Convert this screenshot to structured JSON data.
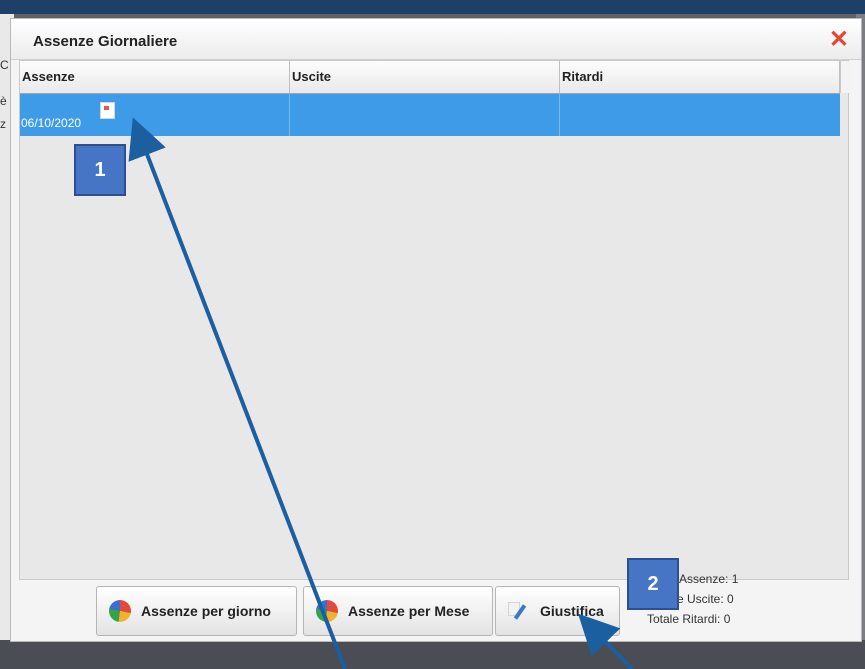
{
  "background": {
    "left_text_lines": [
      "C",
      "è",
      "z"
    ]
  },
  "dialog": {
    "title": "Assenze Giornaliere",
    "close_label": "✕",
    "grid": {
      "columns": [
        "Assenze",
        "Uscite",
        "Ritardi"
      ],
      "rows": [
        {
          "assenze": "06/10/2020",
          "uscite": "",
          "ritardi": ""
        }
      ]
    },
    "buttons": {
      "assenze_per_giorno": "Assenze per giorno",
      "assenze_per_mese": "Assenze per Mese",
      "giustifica": "Giustifica"
    },
    "totals": {
      "assenze": "Assenze: 1",
      "uscite": "e Uscite: 0",
      "ritardi": "Totale Ritardi: 0"
    }
  },
  "annotations": {
    "marker_1": "1",
    "marker_2": "2",
    "arrow_color": "#1b5fa0"
  },
  "colors": {
    "selected_row": "#3d9be8",
    "close": "#e8452c",
    "marker": "#4575c4"
  }
}
